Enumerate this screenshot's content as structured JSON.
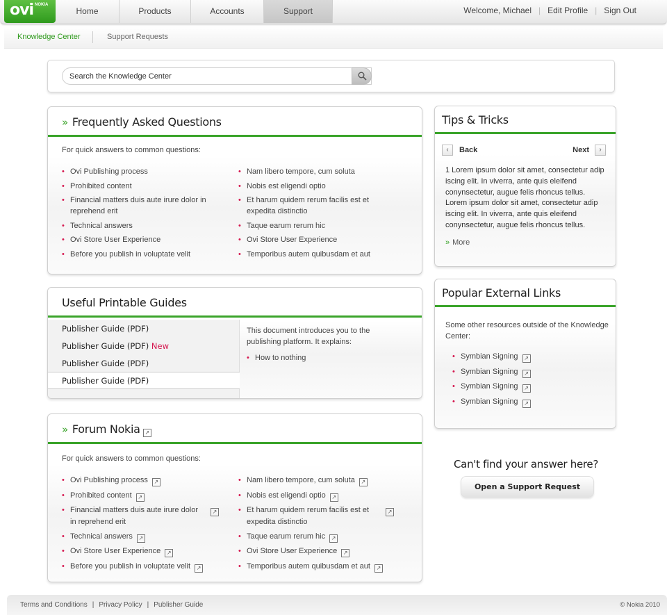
{
  "brand": {
    "logo": "ovi",
    "logo_sub": "NOKIA"
  },
  "nav": {
    "items": [
      "Home",
      "Products",
      "Accounts",
      "Support"
    ],
    "active": "Support"
  },
  "user": {
    "welcome": "Welcome, Michael",
    "edit_profile": "Edit Profile",
    "sign_out": "Sign Out"
  },
  "subnav": {
    "knowledge_center": "Knowledge Center",
    "support_requests": "Support Requests"
  },
  "search": {
    "placeholder": "Search the Knowledge Center",
    "icon": "search-icon"
  },
  "faq": {
    "title": "Frequently Asked Questions",
    "intro": "For quick answers to common questions:",
    "left": [
      "Ovi Publishing process",
      "Prohibited content",
      "Financial matters duis aute irure dolor in reprehend erit",
      "Technical answers",
      "Ovi Store User Experience",
      "Before you publish in voluptate velit"
    ],
    "right": [
      "Nam libero tempore, cum soluta",
      "Nobis est eligendi optio",
      "Et harum quidem rerum facilis est et expedita distinctio",
      "Taque earum rerum hic",
      "Ovi Store User Experience",
      "Temporibus autem quibusdam et aut"
    ]
  },
  "tips": {
    "title": "Tips & Tricks",
    "back": "Back",
    "next": "Next",
    "text": "1 Lorem ipsum dolor sit amet, consectetur adip iscing elit. In viverra, ante quis eleifend conynsectetur, augue felis rhoncus tellus. Lorem ipsum dolor sit amet, consectetur adip iscing elit. In viverra, ante quis eleifend conynsectetur, augue felis rhoncus tellus.",
    "more": "More"
  },
  "guides": {
    "title": "Useful Printable Guides",
    "items": [
      "Publisher Guide (PDF)",
      "Publisher Guide (PDF)",
      "Publisher Guide (PDF)",
      "Publisher Guide (PDF)"
    ],
    "new_badge": "New",
    "description": "This document introduces you to the publishing platform. It explains:",
    "bullets": [
      "How to nothing"
    ]
  },
  "external": {
    "title": "Popular External Links",
    "intro": "Some other resources outside of the Knowledge Center:",
    "links": [
      "Symbian Signing",
      "Symbian Signing",
      "Symbian Signing",
      "Symbian Signing"
    ]
  },
  "forum": {
    "title": "Forum Nokia",
    "intro": "For quick answers to common questions:",
    "left_line1": [
      "Ovi Publishing process",
      "Prohibited content",
      "Financial matters duis aute irure dolor",
      "Technical answers",
      "Ovi Store User Experience",
      "Before you publish in voluptate velit"
    ],
    "left_wrap": "in reprehend erit",
    "right_line1": [
      "Nam libero tempore, cum soluta",
      "Nobis est eligendi optio",
      "Et harum quidem rerum facilis est et",
      "Taque earum rerum hic",
      "Ovi Store User Experience",
      "Temporibus autem quibusdam et aut"
    ],
    "right_wrap": "expedita distinctio"
  },
  "help": {
    "question": "Can't find your answer here?",
    "button": "Open a Support Request"
  },
  "footer": {
    "links": [
      "Terms and Conditions",
      "Privacy Policy",
      "Publisher Guide"
    ],
    "copyright": "© Nokia 2010"
  },
  "colors": {
    "accent_green": "#3aa42a",
    "bullet_red": "#d5184f",
    "logo_green": "#2f9a1d"
  }
}
